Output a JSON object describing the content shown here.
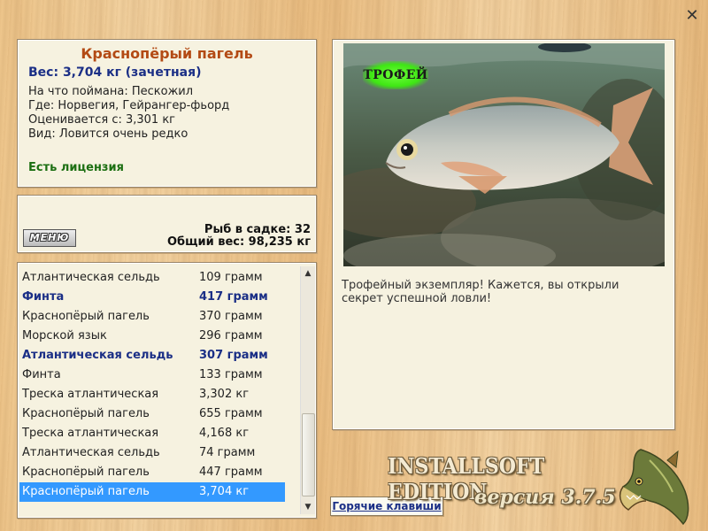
{
  "close_icon": "✕",
  "fish_info": {
    "name": "Краснопёрый пагель",
    "weight": "Вес: 3,704 кг (зачетная)",
    "caught_on": "На что поймана: Пескожил",
    "location": "Где: Норвегия, Гейрангер-фьорд",
    "valued_from": "Оценивается с: 3,301 кг",
    "species_note": "Вид: Ловится очень редко",
    "license": "Есть лицензия"
  },
  "stats": {
    "menu_label": "МЕНЮ",
    "fish_in_keepnet": "Рыб в садке: 32",
    "total_weight": "Общий вес: 98,235 кг"
  },
  "catch_list": [
    {
      "name": "Атлантическая сельдь",
      "weight": "109 грамм",
      "style": "normal"
    },
    {
      "name": "Финта",
      "weight": "417 грамм",
      "style": "bold"
    },
    {
      "name": "Краснопёрый пагель",
      "weight": "370 грамм",
      "style": "normal"
    },
    {
      "name": "Морской язык",
      "weight": "296 грамм",
      "style": "normal"
    },
    {
      "name": "Атлантическая сельдь",
      "weight": "307 грамм",
      "style": "bold"
    },
    {
      "name": "Финта",
      "weight": "133 грамм",
      "style": "normal"
    },
    {
      "name": "Треска атлантическая",
      "weight": "3,302 кг",
      "style": "normal"
    },
    {
      "name": "Краснопёрый пагель",
      "weight": "655 грамм",
      "style": "normal"
    },
    {
      "name": "Треска атлантическая",
      "weight": "4,168 кг",
      "style": "normal"
    },
    {
      "name": "Атлантическая сельдь",
      "weight": "74 грамм",
      "style": "normal"
    },
    {
      "name": "Краснопёрый пагель",
      "weight": "447 грамм",
      "style": "normal"
    },
    {
      "name": "Краснопёрый пагель",
      "weight": "3,704 кг",
      "style": "selected"
    }
  ],
  "photo": {
    "trophy_badge": "ТРОФЕЙ",
    "caption": "Трофейный экземпляр! Кажется, вы открыли секрет успешной ловли!"
  },
  "footer": {
    "hotkeys_label": "Горячие клавиши",
    "brand": "INSTALLSOFT EDITION",
    "version": "версия 3.7.5"
  },
  "colors": {
    "title_orange": "#b34a14",
    "accent_blue": "#1b2f86",
    "license_green": "#1c6f12",
    "selection": "#3399ff"
  }
}
